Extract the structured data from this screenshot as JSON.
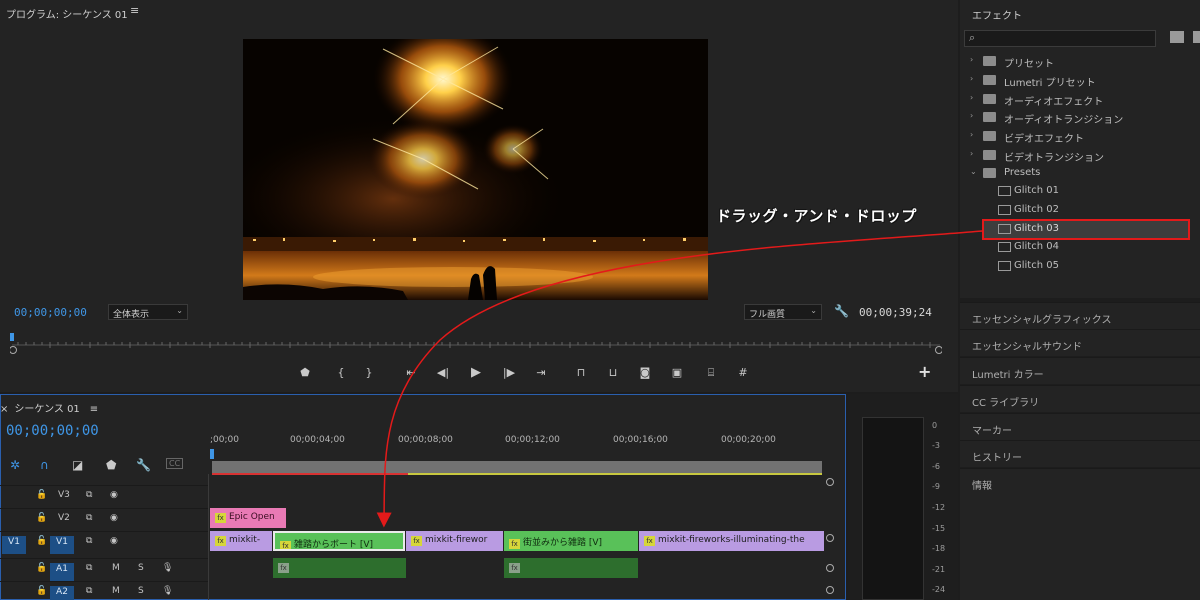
{
  "program": {
    "title": "プログラム: シーケンス 01",
    "menu": "≡",
    "timecode": "00;00;00;00",
    "fit": "全体表示",
    "quality": "フル画質",
    "duration": "00;00;39;24"
  },
  "effects": {
    "title": "エフェクト",
    "items": [
      {
        "label": "プリセット",
        "kind": "bin",
        "expanded": false
      },
      {
        "label": "Lumetri プリセット",
        "kind": "bin",
        "expanded": false
      },
      {
        "label": "オーディオエフェクト",
        "kind": "folder",
        "expanded": false
      },
      {
        "label": "オーディオトランジション",
        "kind": "folder",
        "expanded": false
      },
      {
        "label": "ビデオエフェクト",
        "kind": "folder",
        "expanded": false
      },
      {
        "label": "ビデオトランジション",
        "kind": "folder",
        "expanded": false
      },
      {
        "label": "Presets",
        "kind": "bin",
        "expanded": true
      },
      {
        "label": "Glitch 01",
        "kind": "preset"
      },
      {
        "label": "Glitch 02",
        "kind": "preset"
      },
      {
        "label": "Glitch 03",
        "kind": "preset",
        "selected": true
      },
      {
        "label": "Glitch 04",
        "kind": "preset"
      },
      {
        "label": "Glitch 05",
        "kind": "preset"
      }
    ]
  },
  "side_panels": [
    "エッセンシャルグラフィックス",
    "エッセンシャルサウンド",
    "Lumetri カラー",
    "CC ライブラリ",
    "マーカー",
    "ヒストリー",
    "情報"
  ],
  "timeline": {
    "tab": "シーケンス 01",
    "close": "×",
    "menu": "≡",
    "timecode": "00;00;00;00",
    "ruler": [
      ";00;00",
      "00;00;04;00",
      "00;00;08;00",
      "00;00;12;00",
      "00;00;16;00",
      "00;00;20;00"
    ],
    "tracks": [
      {
        "id": "V3",
        "target": "",
        "type": "video"
      },
      {
        "id": "V2",
        "target": "",
        "type": "video"
      },
      {
        "id": "V1",
        "target": "V1",
        "type": "video"
      },
      {
        "id": "A1",
        "target": "",
        "type": "audio",
        "m": "M",
        "s": "S"
      },
      {
        "id": "A2",
        "target": "",
        "type": "audio",
        "m": "M",
        "s": "S"
      }
    ],
    "clips": {
      "epic_open": "Epic Open",
      "v1_a": "mixkit-",
      "v1_b": "雑踏からボート [V]",
      "v1_c": "mixkit-firewor",
      "v1_d": "街並みから雑踏 [V]",
      "v1_e": "mixkit-fireworks-illuminating-the",
      "fx_badge": "fx"
    }
  },
  "meter": {
    "scale": [
      "0",
      "-3",
      "-6",
      "-9",
      "-12",
      "-15",
      "-18",
      "-21",
      "-24"
    ]
  },
  "annotation": {
    "label": "ドラッグ・アンド・ドロップ",
    "color": "#e31a1a"
  },
  "colors": {
    "timecode": "#3f96e6",
    "accent": "#2a5fae",
    "clip_video": "#b99be2",
    "clip_green": "#59c159",
    "clip_pink": "#e97ab5"
  }
}
